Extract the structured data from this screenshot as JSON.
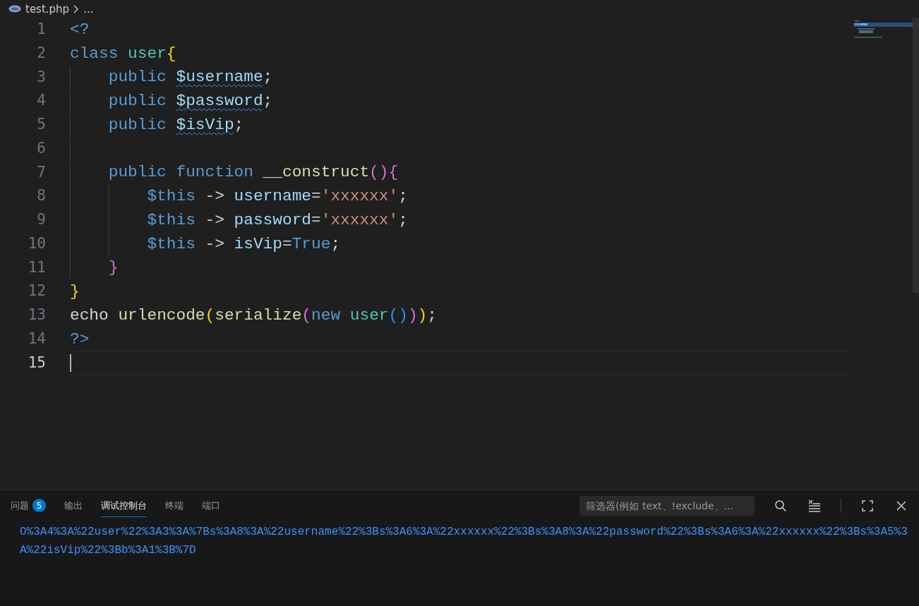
{
  "breadcrumb": {
    "file": "test.php",
    "more": "..."
  },
  "editor": {
    "lines": [
      {
        "number": "1",
        "current": false,
        "tokens": [
          {
            "kind": "keyword",
            "text": "<?"
          }
        ]
      },
      {
        "number": "2",
        "current": false,
        "tokens": [
          {
            "kind": "keyword",
            "text": "class "
          },
          {
            "kind": "type",
            "text": "user"
          },
          {
            "kind": "bracket1",
            "text": "{"
          }
        ]
      },
      {
        "number": "3",
        "current": false,
        "tokens": [
          {
            "kind": "keyword",
            "text": "    public "
          },
          {
            "kind": "variable",
            "text": "$username",
            "squiggle": true
          },
          {
            "kind": "plain",
            "text": ";"
          }
        ]
      },
      {
        "number": "4",
        "current": false,
        "tokens": [
          {
            "kind": "keyword",
            "text": "    public "
          },
          {
            "kind": "variable",
            "text": "$password",
            "squiggle": true
          },
          {
            "kind": "plain",
            "text": ";"
          }
        ]
      },
      {
        "number": "5",
        "current": false,
        "tokens": [
          {
            "kind": "keyword",
            "text": "    public "
          },
          {
            "kind": "variable",
            "text": "$isVip",
            "squiggle": true
          },
          {
            "kind": "plain",
            "text": ";"
          }
        ]
      },
      {
        "number": "6",
        "current": false
      },
      {
        "number": "7",
        "current": false,
        "tokens": [
          {
            "kind": "keyword",
            "text": "    public function "
          },
          {
            "kind": "function",
            "text": "__construct"
          },
          {
            "kind": "bracket2",
            "text": "(){"
          }
        ]
      },
      {
        "number": "8",
        "current": false,
        "tokens": [
          {
            "kind": "keyword",
            "text": "        $this "
          },
          {
            "kind": "plain",
            "text": "-> "
          },
          {
            "kind": "variable",
            "text": "username"
          },
          {
            "kind": "plain",
            "text": "="
          },
          {
            "kind": "string",
            "text": "'xxxxxx'"
          },
          {
            "kind": "plain",
            "text": ";"
          }
        ]
      },
      {
        "number": "9",
        "current": false,
        "tokens": [
          {
            "kind": "keyword",
            "text": "        $this "
          },
          {
            "kind": "plain",
            "text": "-> "
          },
          {
            "kind": "variable",
            "text": "password"
          },
          {
            "kind": "plain",
            "text": "="
          },
          {
            "kind": "string",
            "text": "'xxxxxx'"
          },
          {
            "kind": "plain",
            "text": ";"
          }
        ]
      },
      {
        "number": "10",
        "current": false,
        "tokens": [
          {
            "kind": "keyword",
            "text": "        $this "
          },
          {
            "kind": "plain",
            "text": "-> "
          },
          {
            "kind": "variable",
            "text": "isVip"
          },
          {
            "kind": "plain",
            "text": "="
          },
          {
            "kind": "keyword",
            "text": "True"
          },
          {
            "kind": "plain",
            "text": ";"
          }
        ]
      },
      {
        "number": "11",
        "current": false,
        "tokens": [
          {
            "kind": "bracket2",
            "text": "    }"
          }
        ]
      },
      {
        "number": "12",
        "current": false,
        "tokens": [
          {
            "kind": "bracket1",
            "text": "}"
          }
        ]
      },
      {
        "number": "13",
        "current": false,
        "tokens": [
          {
            "kind": "plain",
            "text": "echo "
          },
          {
            "kind": "function",
            "text": "urlencode"
          },
          {
            "kind": "bracket1",
            "text": "("
          },
          {
            "kind": "function",
            "text": "serialize"
          },
          {
            "kind": "bracket2",
            "text": "("
          },
          {
            "kind": "keyword",
            "text": "new "
          },
          {
            "kind": "type",
            "text": "user"
          },
          {
            "kind": "bracket3",
            "text": "()"
          },
          {
            "kind": "bracket2",
            "text": ")"
          },
          {
            "kind": "bracket1",
            "text": ")"
          },
          {
            "kind": "plain",
            "text": ";"
          }
        ]
      },
      {
        "number": "14",
        "current": false,
        "tokens": [
          {
            "kind": "keyword",
            "text": "?>"
          }
        ]
      },
      {
        "number": "15",
        "current": true
      }
    ]
  },
  "panel": {
    "tabs": [
      {
        "label": "问题",
        "badge": "5",
        "selected": false
      },
      {
        "label": "输出",
        "selected": false
      },
      {
        "label": "调试控制台",
        "selected": true
      },
      {
        "label": "终端",
        "selected": false
      },
      {
        "label": "端口",
        "selected": false
      }
    ],
    "filter": {
      "placeholder": "筛选器(例如 text、!exclude、..."
    },
    "output": "O%3A4%3A%22user%22%3A3%3A%7Bs%3A8%3A%22username%22%3Bs%3A6%3A%22xxxxxx%22%3Bs%3A8%3A%22password%22%3Bs%3A6%3A%22xxxxxx%22%3Bs%3A5%3A%22isVip%22%3Bb%3A1%3B%7D"
  }
}
